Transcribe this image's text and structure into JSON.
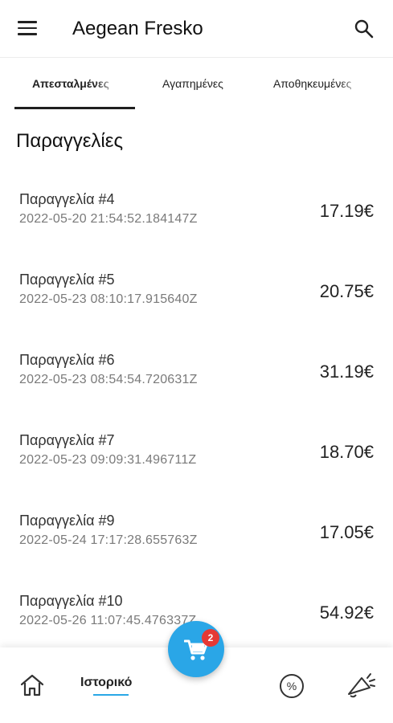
{
  "app": {
    "title": "Aegean Fresko"
  },
  "tabs": [
    {
      "label": "Απεσταλμένες"
    },
    {
      "label": "Αγαπημένες"
    },
    {
      "label": "Αποθηκευμένες"
    }
  ],
  "section": {
    "title": "Παραγγελίες"
  },
  "orders": [
    {
      "name": "Παραγγελία #4",
      "date": "2022-05-20 21:54:52.184147Z",
      "price": "17.19€"
    },
    {
      "name": "Παραγγελία #5",
      "date": "2022-05-23 08:10:17.915640Z",
      "price": "20.75€"
    },
    {
      "name": "Παραγγελία #6",
      "date": "2022-05-23 08:54:54.720631Z",
      "price": "31.19€"
    },
    {
      "name": "Παραγγελία #7",
      "date": "2022-05-23 09:09:31.496711Z",
      "price": "18.70€"
    },
    {
      "name": "Παραγγελία #9",
      "date": "2022-05-24 17:17:28.655763Z",
      "price": "17.05€"
    },
    {
      "name": "Παραγγελία #10",
      "date": "2022-05-26 11:07:45.476337Z",
      "price": "54.92€"
    }
  ],
  "bottom_nav": {
    "active_label": "Ιστορικό",
    "icons": [
      "home-icon",
      "cart-icon",
      "percent-icon",
      "megaphone-icon"
    ]
  },
  "cart": {
    "badge_count": "2"
  },
  "colors": {
    "accent": "#2aa6e7",
    "badge": "#e53935"
  }
}
